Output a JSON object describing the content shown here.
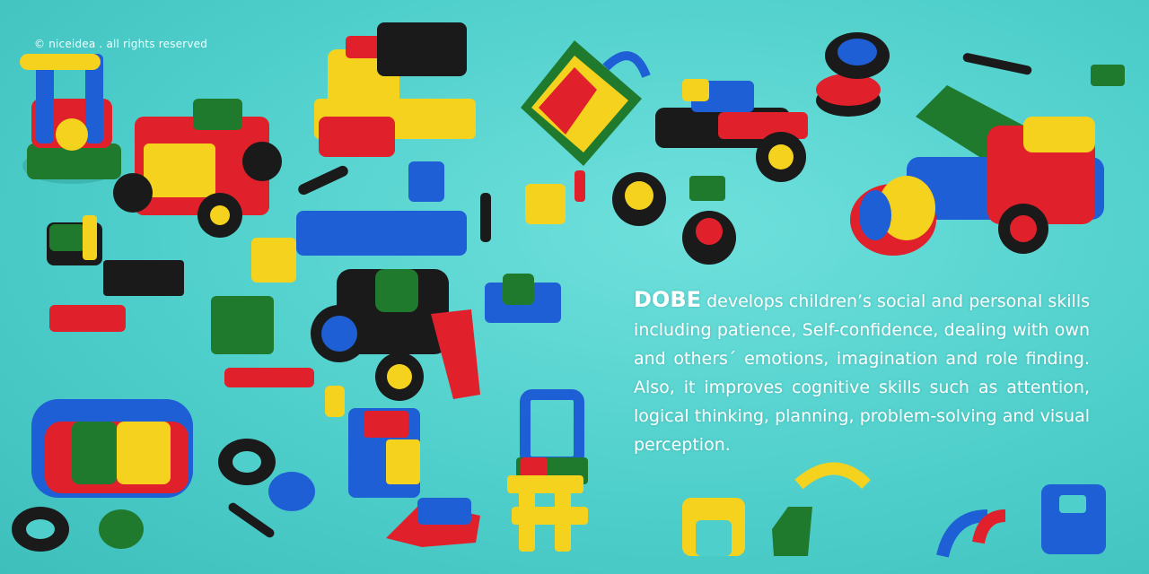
{
  "copyright": "© niceidea  .  all rights reserved",
  "copy": {
    "brand": "DOBE",
    "body": " develops children’s social and personal skills including patience, Self-confidence, dealing with own and others´ emotions, imagination and role finding. Also, it improves cognitive skills such as attention, logical thinking, planning, problem-solving and visual perception."
  },
  "colors": {
    "background": "#4fcfcb",
    "red": "#e0202a",
    "yellow": "#f5d21e",
    "blue": "#1f5fd6",
    "green": "#1f7a2e",
    "black": "#1a1a1a"
  }
}
